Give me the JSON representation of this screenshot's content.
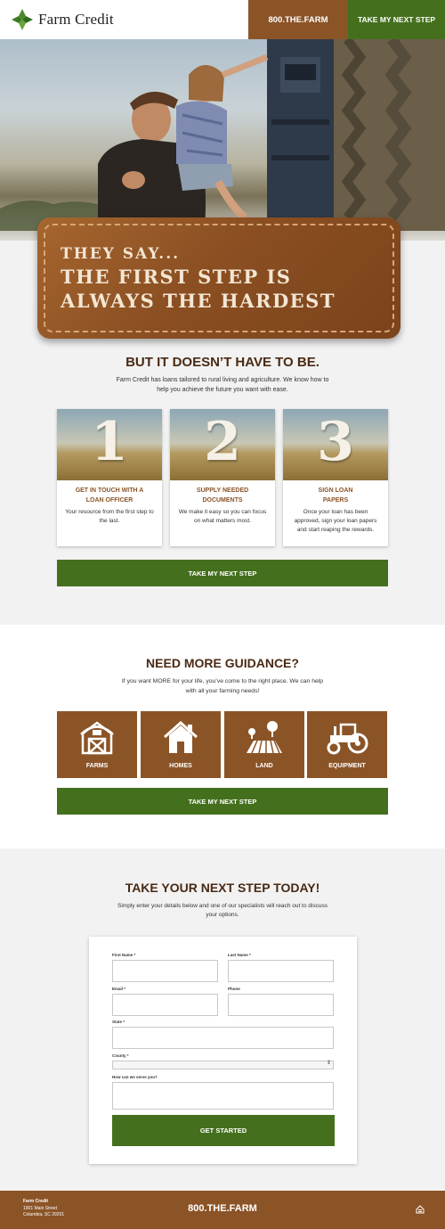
{
  "header": {
    "logo_text": "Farm Credit",
    "phone": "800.THE.FARM",
    "cta": "TAKE MY NEXT STEP"
  },
  "hero": {
    "badge_line1": "THEY SAY...",
    "badge_line2": "THE FIRST STEP IS",
    "badge_line3": "ALWAYS THE HARDEST"
  },
  "steps_section": {
    "title": "BUT IT DOESN’T HAVE TO BE.",
    "subtitle": "Farm Credit has loans tailored to rural living and agriculture. We know how to help you achieve the future you want with ease.",
    "steps": [
      {
        "number": "1",
        "title_line1": "GET IN TOUCH WITH A",
        "title_line2": "LOAN OFFICER",
        "desc": "Your resource from the first step to the last."
      },
      {
        "number": "2",
        "title_line1": "SUPPLY NEEDED",
        "title_line2": "DOCUMENTS",
        "desc": "We make it easy so you can focus on what matters most."
      },
      {
        "number": "3",
        "title_line1": "SIGN LOAN",
        "title_line2": "PAPERS",
        "desc": "Once your loan has been approved, sign your loan papers and start reaping the rewards."
      }
    ],
    "cta": "TAKE MY NEXT STEP"
  },
  "guidance_section": {
    "title": "NEED MORE GUIDANCE?",
    "subtitle": "If you want MORE for your life, you’ve come to the right place. We can help with all your farming needs!",
    "tiles": [
      {
        "label": "FARMS",
        "icon": "barn-icon"
      },
      {
        "label": "HOMES",
        "icon": "house-icon"
      },
      {
        "label": "LAND",
        "icon": "land-icon"
      },
      {
        "label": "EQUIPMENT",
        "icon": "tractor-icon"
      }
    ],
    "cta": "TAKE MY NEXT STEP"
  },
  "form_section": {
    "title": "TAKE YOUR NEXT STEP TODAY!",
    "subtitle": "Simply enter your details below and one of our specialists will reach out to discuss your options.",
    "fields": {
      "first_name": "First Name *",
      "last_name": "Last Name *",
      "email": "Email *",
      "phone": "Phone",
      "state": "State *",
      "county": "County *",
      "message": "How can we serve you?"
    },
    "submit": "GET STARTED"
  },
  "footer": {
    "name": "Farm Credit",
    "address_line1": "1901 Main Street",
    "address_line2": "Columbia, SC 29201",
    "phone": "800.THE.FARM",
    "icon": "equal-housing-icon"
  },
  "colors": {
    "brown": "#8b5427",
    "green": "#44701d",
    "dark_brown_text": "#4a2a14"
  }
}
